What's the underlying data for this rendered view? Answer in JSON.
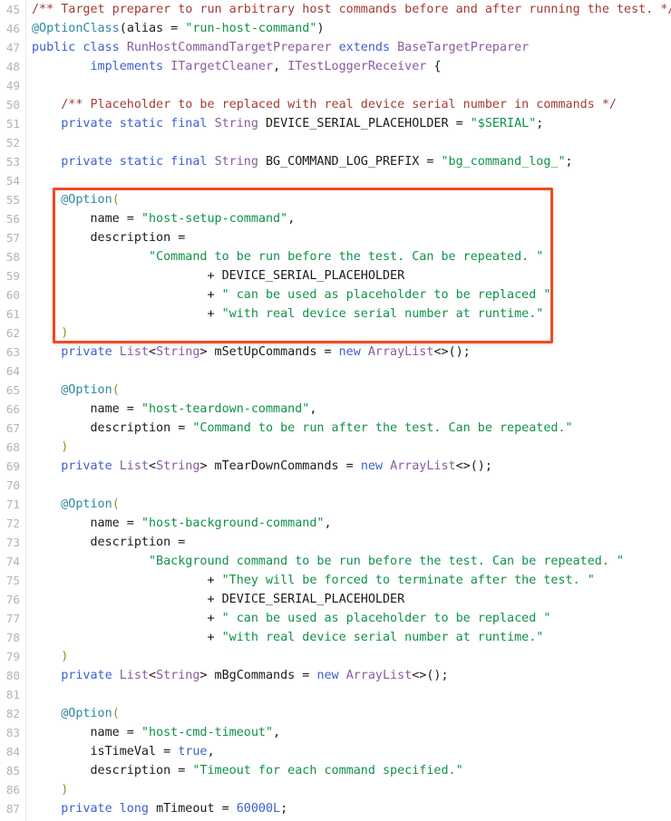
{
  "viewer": {
    "name": "code-viewer",
    "language": "Java",
    "first_line_number": 45,
    "last_line_number": 87,
    "background_color": "#ffffff",
    "gutter_color": "#b3b3b3"
  },
  "highlight": {
    "name": "annotation-highlight-box",
    "color": "#f04a23",
    "covers_lines": "55-62",
    "label": ""
  },
  "colors": {
    "comment": "#a23b36",
    "annotation": "#2b8a9e",
    "keyword": "#3c5fd0",
    "type": "#8a5ba0",
    "string": "#0f9148",
    "number": "#3c5fd0",
    "identifier": "#1a1a1a",
    "annotation_paren": "#9c8b1e",
    "line_number": "#b3b3b3"
  },
  "lines": [
    {
      "n": 45,
      "tokens": [
        {
          "t": "/** Target preparer to run arbitrary host commands before and after running the test. */",
          "c": "t-cmt"
        }
      ]
    },
    {
      "n": 46,
      "tokens": [
        {
          "t": "@OptionClass",
          "c": "t-ann"
        },
        {
          "t": "(",
          "c": "t-pun"
        },
        {
          "t": "alias",
          "c": "t-id"
        },
        {
          "t": " = ",
          "c": "t-pun"
        },
        {
          "t": "\"run-host-command\"",
          "c": "t-str"
        },
        {
          "t": ")",
          "c": "t-pun"
        }
      ]
    },
    {
      "n": 47,
      "tokens": [
        {
          "t": "public class ",
          "c": "t-kw"
        },
        {
          "t": "RunHostCommandTargetPreparer",
          "c": "t-typ"
        },
        {
          "t": " ",
          "c": "t-pun"
        },
        {
          "t": "extends",
          "c": "t-kw"
        },
        {
          "t": " ",
          "c": "t-pun"
        },
        {
          "t": "BaseTargetPreparer",
          "c": "t-typ"
        }
      ]
    },
    {
      "n": 48,
      "tokens": [
        {
          "t": "        ",
          "c": "t-pun"
        },
        {
          "t": "implements",
          "c": "t-kw"
        },
        {
          "t": " ",
          "c": "t-pun"
        },
        {
          "t": "ITargetCleaner",
          "c": "t-typ"
        },
        {
          "t": ", ",
          "c": "t-pun"
        },
        {
          "t": "ITestLoggerReceiver",
          "c": "t-typ"
        },
        {
          "t": " {",
          "c": "t-pun"
        }
      ]
    },
    {
      "n": 49,
      "tokens": []
    },
    {
      "n": 50,
      "tokens": [
        {
          "t": "    ",
          "c": "t-pun"
        },
        {
          "t": "/** Placeholder to be replaced with real device serial number in commands */",
          "c": "t-cmt"
        }
      ]
    },
    {
      "n": 51,
      "tokens": [
        {
          "t": "    ",
          "c": "t-pun"
        },
        {
          "t": "private static final ",
          "c": "t-kw"
        },
        {
          "t": "String",
          "c": "t-typ"
        },
        {
          "t": " DEVICE_SERIAL_PLACEHOLDER = ",
          "c": "t-id"
        },
        {
          "t": "\"$SERIAL\"",
          "c": "t-str"
        },
        {
          "t": ";",
          "c": "t-pun"
        }
      ]
    },
    {
      "n": 52,
      "tokens": []
    },
    {
      "n": 53,
      "tokens": [
        {
          "t": "    ",
          "c": "t-pun"
        },
        {
          "t": "private static final ",
          "c": "t-kw"
        },
        {
          "t": "String",
          "c": "t-typ"
        },
        {
          "t": " BG_COMMAND_LOG_PREFIX = ",
          "c": "t-id"
        },
        {
          "t": "\"bg_command_log_\"",
          "c": "t-str"
        },
        {
          "t": ";",
          "c": "t-pun"
        }
      ]
    },
    {
      "n": 54,
      "tokens": []
    },
    {
      "n": 55,
      "tokens": [
        {
          "t": "    ",
          "c": "t-pun"
        },
        {
          "t": "@Option",
          "c": "t-ann"
        },
        {
          "t": "(",
          "c": "t-apun"
        }
      ]
    },
    {
      "n": 56,
      "tokens": [
        {
          "t": "        ",
          "c": "t-pun"
        },
        {
          "t": "name",
          "c": "t-id"
        },
        {
          "t": " = ",
          "c": "t-pun"
        },
        {
          "t": "\"host-setup-command\"",
          "c": "t-str"
        },
        {
          "t": ",",
          "c": "t-pun"
        }
      ]
    },
    {
      "n": 57,
      "tokens": [
        {
          "t": "        ",
          "c": "t-pun"
        },
        {
          "t": "description",
          "c": "t-id"
        },
        {
          "t": " =",
          "c": "t-pun"
        }
      ]
    },
    {
      "n": 58,
      "tokens": [
        {
          "t": "                ",
          "c": "t-pun"
        },
        {
          "t": "\"Command to be run before the test. Can be repeated. \"",
          "c": "t-str"
        }
      ]
    },
    {
      "n": 59,
      "tokens": [
        {
          "t": "                        + ",
          "c": "t-pun"
        },
        {
          "t": "DEVICE_SERIAL_PLACEHOLDER",
          "c": "t-id"
        }
      ]
    },
    {
      "n": 60,
      "tokens": [
        {
          "t": "                        + ",
          "c": "t-pun"
        },
        {
          "t": "\" can be used as placeholder to be replaced \"",
          "c": "t-str"
        }
      ]
    },
    {
      "n": 61,
      "tokens": [
        {
          "t": "                        + ",
          "c": "t-pun"
        },
        {
          "t": "\"with real device serial number at runtime.\"",
          "c": "t-str"
        }
      ]
    },
    {
      "n": 62,
      "tokens": [
        {
          "t": "    ",
          "c": "t-pun"
        },
        {
          "t": ")",
          "c": "t-apun"
        }
      ]
    },
    {
      "n": 63,
      "tokens": [
        {
          "t": "    ",
          "c": "t-pun"
        },
        {
          "t": "private ",
          "c": "t-kw"
        },
        {
          "t": "List",
          "c": "t-typ"
        },
        {
          "t": "<",
          "c": "t-pun"
        },
        {
          "t": "String",
          "c": "t-typ"
        },
        {
          "t": "> mSetUpCommands = ",
          "c": "t-id"
        },
        {
          "t": "new ",
          "c": "t-kw"
        },
        {
          "t": "ArrayList",
          "c": "t-typ"
        },
        {
          "t": "<>();",
          "c": "t-pun"
        }
      ]
    },
    {
      "n": 64,
      "tokens": []
    },
    {
      "n": 65,
      "tokens": [
        {
          "t": "    ",
          "c": "t-pun"
        },
        {
          "t": "@Option",
          "c": "t-ann"
        },
        {
          "t": "(",
          "c": "t-apun"
        }
      ]
    },
    {
      "n": 66,
      "tokens": [
        {
          "t": "        ",
          "c": "t-pun"
        },
        {
          "t": "name",
          "c": "t-id"
        },
        {
          "t": " = ",
          "c": "t-pun"
        },
        {
          "t": "\"host-teardown-command\"",
          "c": "t-str"
        },
        {
          "t": ",",
          "c": "t-pun"
        }
      ]
    },
    {
      "n": 67,
      "tokens": [
        {
          "t": "        ",
          "c": "t-pun"
        },
        {
          "t": "description",
          "c": "t-id"
        },
        {
          "t": " = ",
          "c": "t-pun"
        },
        {
          "t": "\"Command to be run after the test. Can be repeated.\"",
          "c": "t-str"
        }
      ]
    },
    {
      "n": 68,
      "tokens": [
        {
          "t": "    ",
          "c": "t-pun"
        },
        {
          "t": ")",
          "c": "t-apun"
        }
      ]
    },
    {
      "n": 69,
      "tokens": [
        {
          "t": "    ",
          "c": "t-pun"
        },
        {
          "t": "private ",
          "c": "t-kw"
        },
        {
          "t": "List",
          "c": "t-typ"
        },
        {
          "t": "<",
          "c": "t-pun"
        },
        {
          "t": "String",
          "c": "t-typ"
        },
        {
          "t": "> mTearDownCommands = ",
          "c": "t-id"
        },
        {
          "t": "new ",
          "c": "t-kw"
        },
        {
          "t": "ArrayList",
          "c": "t-typ"
        },
        {
          "t": "<>();",
          "c": "t-pun"
        }
      ]
    },
    {
      "n": 70,
      "tokens": []
    },
    {
      "n": 71,
      "tokens": [
        {
          "t": "    ",
          "c": "t-pun"
        },
        {
          "t": "@Option",
          "c": "t-ann"
        },
        {
          "t": "(",
          "c": "t-apun"
        }
      ]
    },
    {
      "n": 72,
      "tokens": [
        {
          "t": "        ",
          "c": "t-pun"
        },
        {
          "t": "name",
          "c": "t-id"
        },
        {
          "t": " = ",
          "c": "t-pun"
        },
        {
          "t": "\"host-background-command\"",
          "c": "t-str"
        },
        {
          "t": ",",
          "c": "t-pun"
        }
      ]
    },
    {
      "n": 73,
      "tokens": [
        {
          "t": "        ",
          "c": "t-pun"
        },
        {
          "t": "description",
          "c": "t-id"
        },
        {
          "t": " =",
          "c": "t-pun"
        }
      ]
    },
    {
      "n": 74,
      "tokens": [
        {
          "t": "                ",
          "c": "t-pun"
        },
        {
          "t": "\"Background command to be run before the test. Can be repeated. \"",
          "c": "t-str"
        }
      ]
    },
    {
      "n": 75,
      "tokens": [
        {
          "t": "                        + ",
          "c": "t-pun"
        },
        {
          "t": "\"They will be forced to terminate after the test. \"",
          "c": "t-str"
        }
      ]
    },
    {
      "n": 76,
      "tokens": [
        {
          "t": "                        + ",
          "c": "t-pun"
        },
        {
          "t": "DEVICE_SERIAL_PLACEHOLDER",
          "c": "t-id"
        }
      ]
    },
    {
      "n": 77,
      "tokens": [
        {
          "t": "                        + ",
          "c": "t-pun"
        },
        {
          "t": "\" can be used as placeholder to be replaced \"",
          "c": "t-str"
        }
      ]
    },
    {
      "n": 78,
      "tokens": [
        {
          "t": "                        + ",
          "c": "t-pun"
        },
        {
          "t": "\"with real device serial number at runtime.\"",
          "c": "t-str"
        }
      ]
    },
    {
      "n": 79,
      "tokens": [
        {
          "t": "    ",
          "c": "t-pun"
        },
        {
          "t": ")",
          "c": "t-apun"
        }
      ]
    },
    {
      "n": 80,
      "tokens": [
        {
          "t": "    ",
          "c": "t-pun"
        },
        {
          "t": "private ",
          "c": "t-kw"
        },
        {
          "t": "List",
          "c": "t-typ"
        },
        {
          "t": "<",
          "c": "t-pun"
        },
        {
          "t": "String",
          "c": "t-typ"
        },
        {
          "t": "> mBgCommands = ",
          "c": "t-id"
        },
        {
          "t": "new ",
          "c": "t-kw"
        },
        {
          "t": "ArrayList",
          "c": "t-typ"
        },
        {
          "t": "<>();",
          "c": "t-pun"
        }
      ]
    },
    {
      "n": 81,
      "tokens": []
    },
    {
      "n": 82,
      "tokens": [
        {
          "t": "    ",
          "c": "t-pun"
        },
        {
          "t": "@Option",
          "c": "t-ann"
        },
        {
          "t": "(",
          "c": "t-apun"
        }
      ]
    },
    {
      "n": 83,
      "tokens": [
        {
          "t": "        ",
          "c": "t-pun"
        },
        {
          "t": "name",
          "c": "t-id"
        },
        {
          "t": " = ",
          "c": "t-pun"
        },
        {
          "t": "\"host-cmd-timeout\"",
          "c": "t-str"
        },
        {
          "t": ",",
          "c": "t-pun"
        }
      ]
    },
    {
      "n": 84,
      "tokens": [
        {
          "t": "        ",
          "c": "t-pun"
        },
        {
          "t": "isTimeVal",
          "c": "t-id"
        },
        {
          "t": " = ",
          "c": "t-pun"
        },
        {
          "t": "true",
          "c": "t-kw"
        },
        {
          "t": ",",
          "c": "t-pun"
        }
      ]
    },
    {
      "n": 85,
      "tokens": [
        {
          "t": "        ",
          "c": "t-pun"
        },
        {
          "t": "description",
          "c": "t-id"
        },
        {
          "t": " = ",
          "c": "t-pun"
        },
        {
          "t": "\"Timeout for each command specified.\"",
          "c": "t-str"
        }
      ]
    },
    {
      "n": 86,
      "tokens": [
        {
          "t": "    ",
          "c": "t-pun"
        },
        {
          "t": ")",
          "c": "t-apun"
        }
      ]
    },
    {
      "n": 87,
      "tokens": [
        {
          "t": "    ",
          "c": "t-pun"
        },
        {
          "t": "private long ",
          "c": "t-kw"
        },
        {
          "t": "mTimeout = ",
          "c": "t-id"
        },
        {
          "t": "60000L",
          "c": "t-num"
        },
        {
          "t": ";",
          "c": "t-pun"
        }
      ]
    }
  ]
}
